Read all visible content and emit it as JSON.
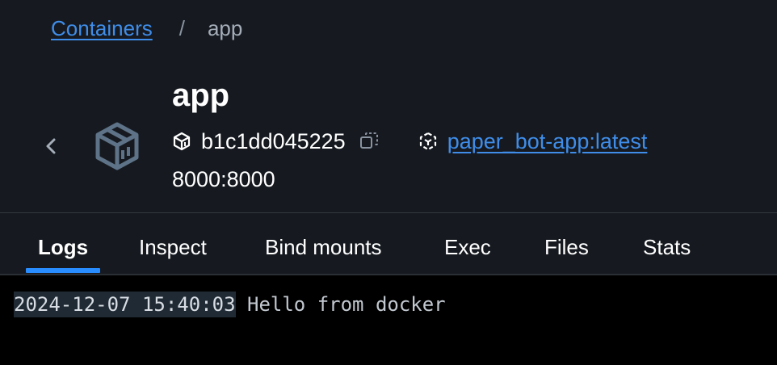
{
  "breadcrumb": {
    "parent": "Containers",
    "separator": "/",
    "current": "app"
  },
  "container": {
    "name": "app",
    "id": "b1c1dd045225",
    "image": "paper_bot-app:latest",
    "ports": "8000:8000"
  },
  "tabs": [
    {
      "label": "Logs",
      "active": true
    },
    {
      "label": "Inspect",
      "active": false
    },
    {
      "label": "Bind mounts",
      "active": false
    },
    {
      "label": "Exec",
      "active": false
    },
    {
      "label": "Files",
      "active": false
    },
    {
      "label": "Stats",
      "active": false
    }
  ],
  "logs": [
    {
      "timestamp": "2024-12-07 15:40:03",
      "message": " Hello from docker"
    }
  ],
  "icons": {
    "back": "chevron-left-icon",
    "container": "container-box-icon",
    "id": "container-id-icon",
    "copy": "copy-icon",
    "image": "image-icon"
  },
  "colors": {
    "background": "#161a20",
    "link": "#3f8de9",
    "accent": "#2a8dff",
    "log_background": "#000000"
  }
}
